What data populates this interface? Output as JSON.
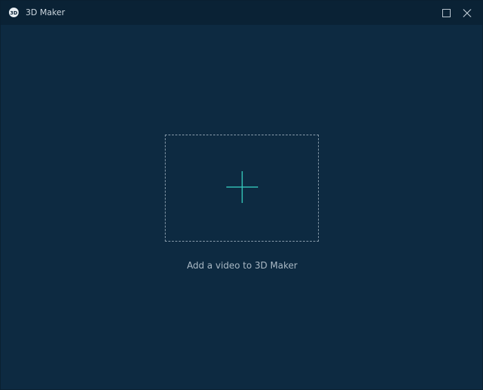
{
  "window": {
    "title": "3D Maker",
    "app_icon": "3d-badge-icon",
    "controls": [
      "maximize-icon",
      "close-icon"
    ]
  },
  "main": {
    "add_video_hint": "Add a video to 3D Maker",
    "dropzone_icon": "plus-icon"
  },
  "colors": {
    "background": "#0d2a41",
    "titlebar": "#0a2235",
    "accent": "#35c4b9",
    "dash_border": "#8ea1b0",
    "text": "#a9b8c4"
  }
}
